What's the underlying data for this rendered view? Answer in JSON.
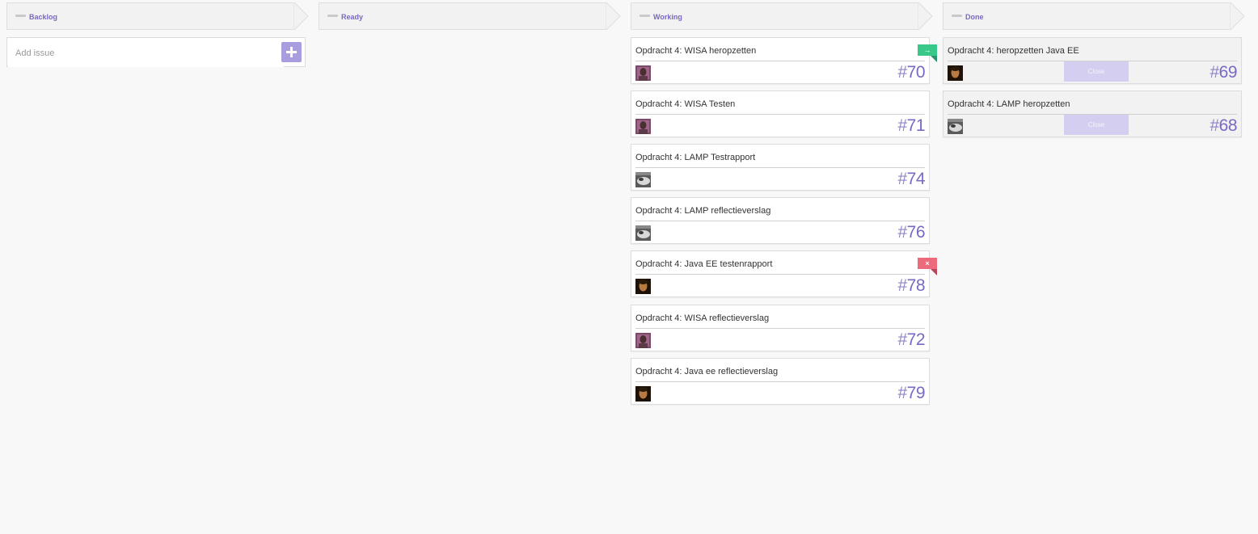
{
  "columns": {
    "backlog": {
      "title": "Backlog"
    },
    "ready": {
      "title": "Ready"
    },
    "working": {
      "title": "Working"
    },
    "done": {
      "title": "Done"
    }
  },
  "add_issue": {
    "placeholder": "Add issue"
  },
  "working_cards": [
    {
      "title": "Opdracht 4: WISA heropzetten",
      "hash": "#",
      "number": "70",
      "flag": "→"
    },
    {
      "title": "Opdracht 4: WISA Testen",
      "hash": "#",
      "number": "71"
    },
    {
      "title": "Opdracht 4: LAMP Testrapport",
      "hash": "#",
      "number": "74"
    },
    {
      "title": "Opdracht 4: LAMP reflectieverslag",
      "hash": "#",
      "number": "76"
    },
    {
      "title": "Opdracht 4: Java EE testenrapport",
      "hash": "#",
      "number": "78",
      "flag": "×"
    },
    {
      "title": "Opdracht 4: WISA reflectieverslag",
      "hash": "#",
      "number": "72"
    },
    {
      "title": "Opdracht 4: Java ee reflectieverslag",
      "hash": "#",
      "number": "79"
    }
  ],
  "done_cards": [
    {
      "title": "Opdracht 4: heropzetten Java EE",
      "hash": "#",
      "number": "69",
      "close_label": "Close"
    },
    {
      "title": "Opdracht 4: LAMP heropzetten",
      "hash": "#",
      "number": "68",
      "close_label": "Close"
    }
  ],
  "colors": {
    "accent": "#7b68c2",
    "flag_green": "#37c88a",
    "flag_red": "#ec6a7c",
    "close_button": "#d4cff0"
  }
}
